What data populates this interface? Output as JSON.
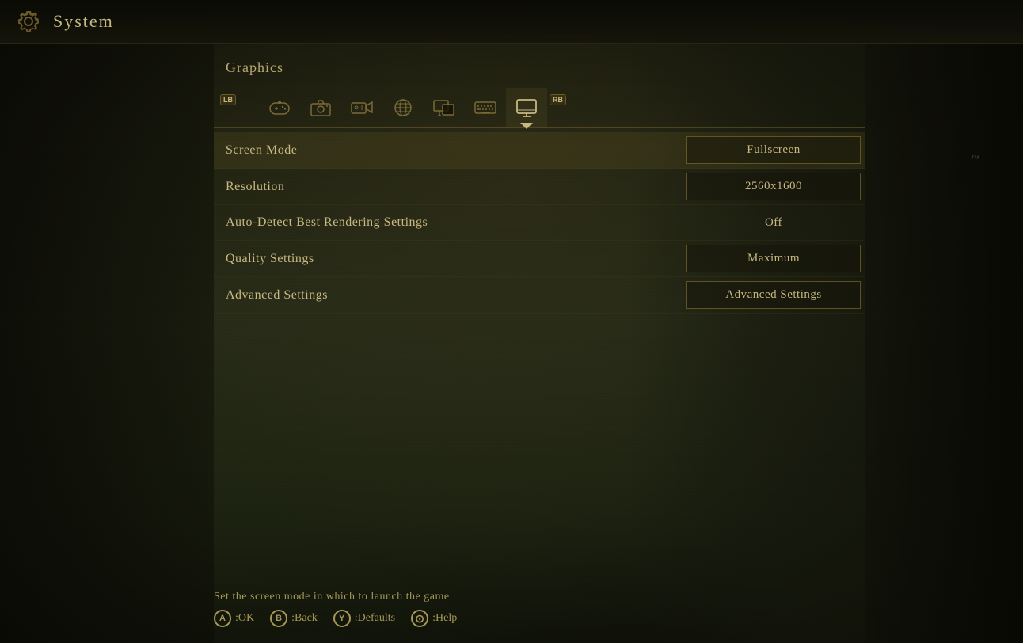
{
  "header": {
    "icon": "gear",
    "title": "System",
    "tm": "™"
  },
  "section": {
    "title": "Graphics"
  },
  "tabs": [
    {
      "id": "lb",
      "icon": "LB",
      "label": "LB",
      "badge": true,
      "active": false
    },
    {
      "id": "gamepad",
      "icon": "🎮",
      "label": "Gamepad",
      "badge": false,
      "active": false
    },
    {
      "id": "camera",
      "icon": "📷",
      "label": "Camera",
      "badge": false,
      "active": false
    },
    {
      "id": "motion",
      "icon": "📹",
      "label": "Motion Controls",
      "badge": false,
      "active": false
    },
    {
      "id": "globe",
      "icon": "🌐",
      "label": "Network",
      "badge": false,
      "active": false
    },
    {
      "id": "display2",
      "icon": "🖥",
      "label": "Display2",
      "badge": false,
      "active": false
    },
    {
      "id": "keyboard",
      "icon": "⌨",
      "label": "Keyboard",
      "badge": false,
      "active": false
    },
    {
      "id": "monitor",
      "icon": "🖥",
      "label": "Graphics",
      "badge": false,
      "active": true
    },
    {
      "id": "rb",
      "icon": "RB",
      "label": "RB",
      "badge": true,
      "active": false
    }
  ],
  "settings": [
    {
      "id": "screen-mode",
      "label": "Screen Mode",
      "value": "Fullscreen",
      "type": "box",
      "highlighted": true
    },
    {
      "id": "resolution",
      "label": "Resolution",
      "value": "2560x1600",
      "type": "box",
      "highlighted": false
    },
    {
      "id": "auto-detect",
      "label": "Auto-Detect Best Rendering Settings",
      "value": "Off",
      "type": "text",
      "highlighted": false
    },
    {
      "id": "quality-settings",
      "label": "Quality Settings",
      "value": "Maximum",
      "type": "box",
      "highlighted": false
    },
    {
      "id": "advanced-settings",
      "label": "Advanced Settings",
      "value": "Advanced Settings",
      "type": "box",
      "highlighted": false
    }
  ],
  "hint": {
    "text": "Set the screen mode in which to launch the game"
  },
  "controls": [
    {
      "button": "A",
      "action": "OK"
    },
    {
      "button": "B",
      "action": "Back"
    },
    {
      "button": "Y",
      "action": "Defaults"
    },
    {
      "button": "⊙",
      "action": "Help"
    }
  ]
}
